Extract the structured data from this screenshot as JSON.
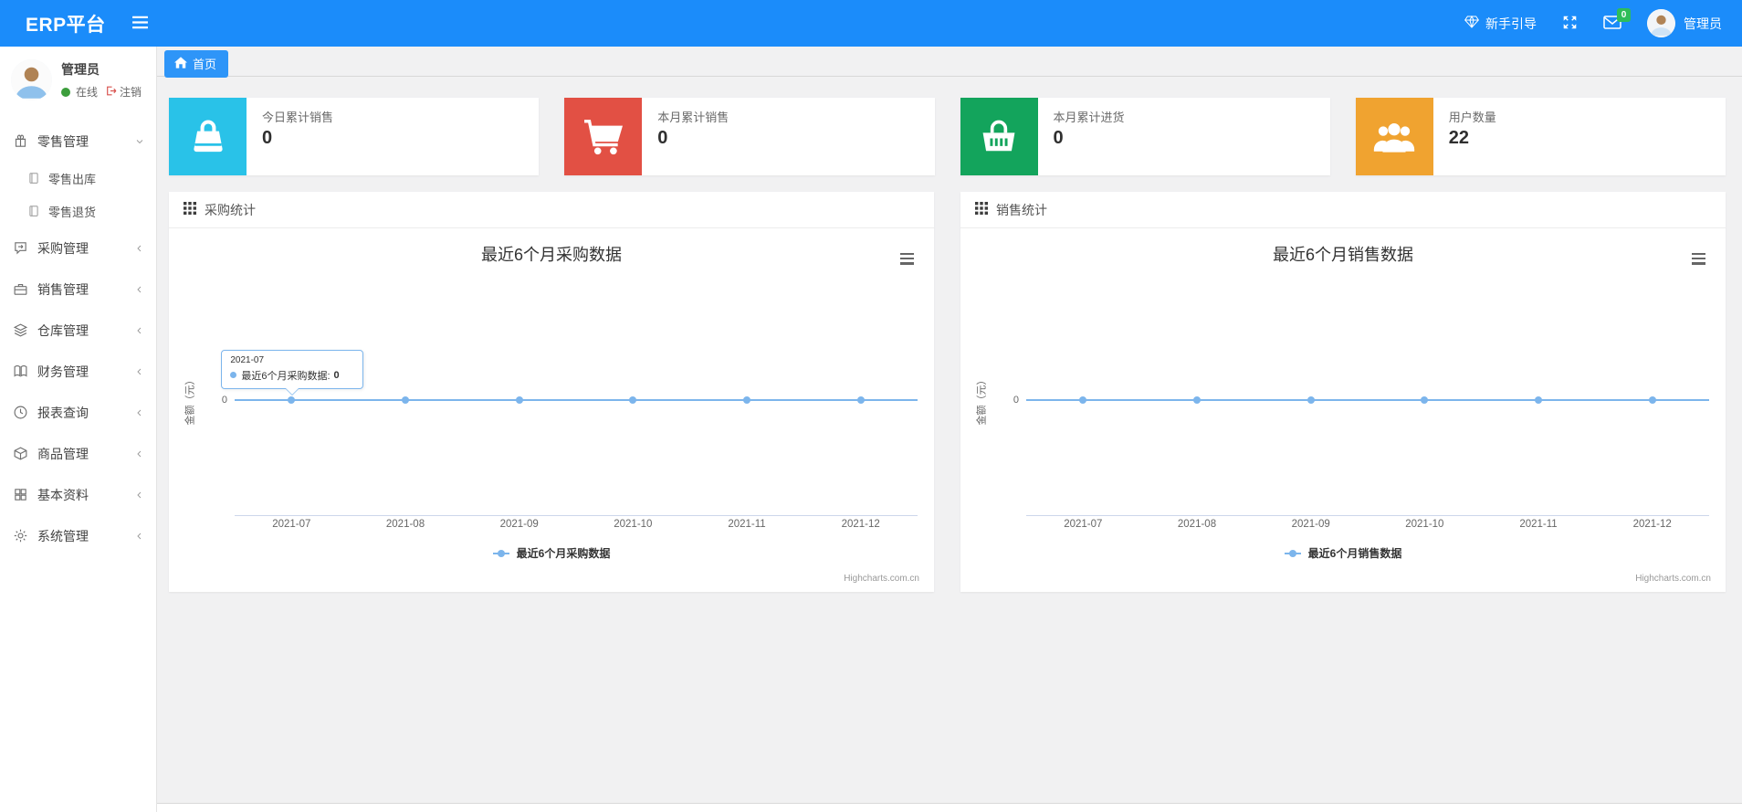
{
  "navbar": {
    "brand": "ERP平台",
    "guide_label": "新手引导",
    "mail_badge": "0",
    "username": "管理员"
  },
  "sidebar": {
    "user": {
      "name": "管理员",
      "status": "在线",
      "logout": "注销"
    },
    "menu": [
      {
        "label": "零售管理",
        "icon": "gift-icon",
        "state": "expanded",
        "children": [
          "零售出库",
          "零售退货"
        ]
      },
      {
        "label": "采购管理",
        "icon": "chat-icon"
      },
      {
        "label": "销售管理",
        "icon": "briefcase-icon"
      },
      {
        "label": "仓库管理",
        "icon": "layers-icon"
      },
      {
        "label": "财务管理",
        "icon": "book-icon"
      },
      {
        "label": "报表查询",
        "icon": "clock-icon"
      },
      {
        "label": "商品管理",
        "icon": "package-icon"
      },
      {
        "label": "基本资料",
        "icon": "grid-icon"
      },
      {
        "label": "系统管理",
        "icon": "gear-icon"
      }
    ]
  },
  "tabs": {
    "home": "首页"
  },
  "stat_cards": [
    {
      "title": "今日累计销售",
      "value": "0",
      "color": "#29c2e8",
      "icon": "shopping-bag-icon"
    },
    {
      "title": "本月累计销售",
      "value": "0",
      "color": "#e25044",
      "icon": "shopping-cart-icon"
    },
    {
      "title": "本月累计进货",
      "value": "0",
      "color": "#13a45c",
      "icon": "shopping-basket-icon"
    },
    {
      "title": "用户数量",
      "value": "22",
      "color": "#f0a330",
      "icon": "users-icon"
    }
  ],
  "panels": [
    {
      "title": "采购统计"
    },
    {
      "title": "销售统计"
    }
  ],
  "chart_data": [
    {
      "type": "line",
      "title": "最近6个月采购数据",
      "categories": [
        "2021-07",
        "2021-08",
        "2021-09",
        "2021-10",
        "2021-11",
        "2021-12"
      ],
      "series": [
        {
          "name": "最近6个月采购数据",
          "values": [
            0,
            0,
            0,
            0,
            0,
            0
          ]
        }
      ],
      "xlabel": "",
      "ylabel": "金额（元）",
      "ytick": "0",
      "ylim": [
        -1,
        1
      ],
      "grid": false,
      "legend_position": "bottom",
      "line_color": "#7cb5ec",
      "credits": "Highcharts.com.cn",
      "tooltip": {
        "visible": true,
        "category": "2021-07",
        "series_label": "最近6个月采购数据:",
        "value": "0"
      }
    },
    {
      "type": "line",
      "title": "最近6个月销售数据",
      "categories": [
        "2021-07",
        "2021-08",
        "2021-09",
        "2021-10",
        "2021-11",
        "2021-12"
      ],
      "series": [
        {
          "name": "最近6个月销售数据",
          "values": [
            0,
            0,
            0,
            0,
            0,
            0
          ]
        }
      ],
      "xlabel": "",
      "ylabel": "金额（元）",
      "ytick": "0",
      "ylim": [
        -1,
        1
      ],
      "grid": false,
      "legend_position": "bottom",
      "line_color": "#7cb5ec",
      "credits": "Highcharts.com.cn",
      "tooltip": {
        "visible": false
      }
    }
  ]
}
